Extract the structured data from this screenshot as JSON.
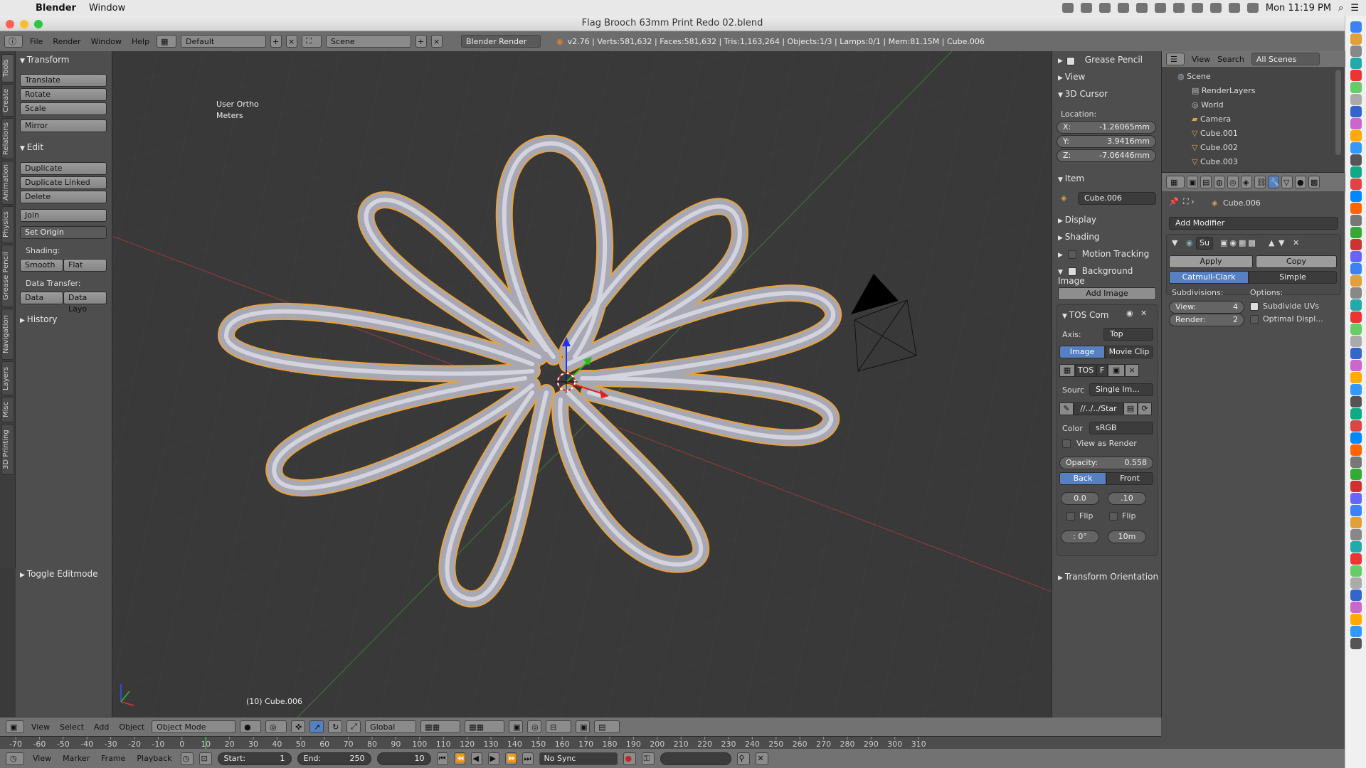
{
  "mac": {
    "app": "Blender",
    "menus": [
      "Window"
    ],
    "clock": "Mon 11:19 PM"
  },
  "window": {
    "title": "Flag Brooch 63mm Print Redo 02.blend"
  },
  "info": {
    "menus": [
      "File",
      "Render",
      "Window",
      "Help"
    ],
    "layout": "Default",
    "scene": "Scene",
    "engine": "Blender Render",
    "stats": "v2.76 | Verts:581,632 | Faces:581,632 | Tris:1,163,264 | Objects:1/3 | Lamps:0/1 | Mem:81.15M | Cube.006"
  },
  "tabs": [
    "Tools",
    "Create",
    "Relations",
    "Animation",
    "Physics",
    "Grease Pencil",
    "Navigation",
    "Layers",
    "Misc",
    "3D Printing"
  ],
  "tools": {
    "transform_title": "Transform",
    "transform": [
      "Translate",
      "Rotate",
      "Scale"
    ],
    "mirror": "Mirror",
    "edit_title": "Edit",
    "edit": [
      "Duplicate",
      "Duplicate Linked",
      "Delete"
    ],
    "join": "Join",
    "set_origin": "Set Origin",
    "shading_label": "Shading:",
    "smooth": "Smooth",
    "flat": "Flat",
    "data_transfer_label": "Data Transfer:",
    "data": "Data",
    "data_layo": "Data Layo",
    "history": "History",
    "toggle_editmode": "Toggle Editmode"
  },
  "viewport": {
    "view_name": "User Ortho",
    "units": "Meters",
    "active": "(10) Cube.006"
  },
  "npanel": {
    "grease_pencil": "Grease Pencil",
    "view": "View",
    "cursor": "3D Cursor",
    "location": "Location:",
    "x": "X:",
    "x_val": "-1.26065mm",
    "y": "Y:",
    "y_val": "3.9416mm",
    "z": "Z:",
    "z_val": "-7.06446mm",
    "item": "Item",
    "item_name": "Cube.006",
    "display": "Display",
    "shading": "Shading",
    "motion": "Motion Tracking",
    "bg_image": "Background Image",
    "add_image": "Add Image",
    "tos": "TOS Com",
    "axis": "Axis:",
    "axis_val": "Top",
    "image": "Image",
    "movie": "Movie Clip",
    "tos2": "TOS",
    "f": "F",
    "source": "Sourc",
    "source_val": "Single Im...",
    "path": "//../../Star",
    "color": "Color",
    "color_val": "sRGB",
    "view_render": "View as Render",
    "opacity": "Opacity:",
    "opacity_val": "0.558",
    "back": "Back",
    "front": "Front",
    "v1": "0.0",
    "v2": ".10",
    "flip1": "Flip",
    "flip2": "Flip",
    "v3": ": 0°",
    "v4": "10m",
    "transform_orient": "Transform Orientation"
  },
  "outliner": {
    "menus": [
      "View",
      "Search"
    ],
    "filter": "All Scenes",
    "rows": [
      "Scene",
      "RenderLayers",
      "World",
      "Camera",
      "Cube.001",
      "Cube.002",
      "Cube.003"
    ]
  },
  "props": {
    "object": "Cube.006",
    "add_modifier": "Add Modifier",
    "mod_name": "Su",
    "apply": "Apply",
    "copy": "Copy",
    "catmull": "Catmull-Clark",
    "simple": "Simple",
    "subdivisions": "Subdivisions:",
    "options": "Options:",
    "view": "View:",
    "view_val": "4",
    "render": "Render:",
    "render_val": "2",
    "subdiv_uvs": "Subdivide UVs",
    "optimal": "Optimal Displ..."
  },
  "v3dhead": {
    "menus": [
      "View",
      "Select",
      "Add",
      "Object"
    ],
    "mode": "Object Mode",
    "orientation": "Global"
  },
  "ruler": [
    "-70",
    "-60",
    "-50",
    "-40",
    "-30",
    "-20",
    "-10",
    "0",
    "10",
    "20",
    "30",
    "40",
    "50",
    "60",
    "70",
    "80",
    "90",
    "100",
    "110",
    "120",
    "130",
    "140",
    "150",
    "160",
    "170",
    "180",
    "190",
    "200",
    "210",
    "220",
    "230",
    "240",
    "250",
    "260",
    "270",
    "280",
    "290",
    "300",
    "310"
  ],
  "timeline": {
    "menus": [
      "View",
      "Marker",
      "Frame",
      "Playback"
    ],
    "start": "Start:",
    "start_val": "1",
    "end": "End:",
    "end_val": "250",
    "current": "10",
    "sync": "No Sync"
  }
}
